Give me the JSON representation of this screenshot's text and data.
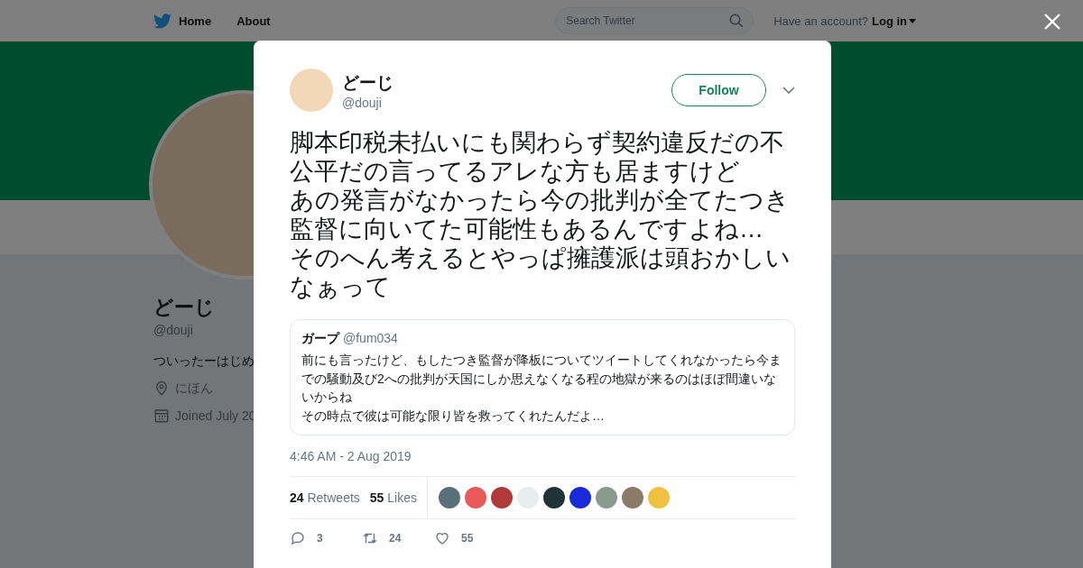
{
  "nav": {
    "items": [
      "Home",
      "About"
    ],
    "search": {
      "placeholder": "Search Twitter"
    },
    "account_prompt": "Have an account?",
    "login": "Log in"
  },
  "profile": {
    "name": "どーじ",
    "handle": "@douji",
    "bio": "ついったーはじめ",
    "location": "にほん",
    "joined": "Joined July 20"
  },
  "tweet": {
    "name": "どーじ",
    "handle": "@douji",
    "follow": "Follow",
    "text": [
      "脚本印税未払いにも関わらず契約違反だの不公平だの言ってるアレな方も居ますけど",
      "あの発言がなかったら今の批判が全てたつき監督に向いてた可能性もあるんですよね…",
      "そのへん考えるとやっぱ擁護派は頭おかしいなぁって"
    ],
    "quote": {
      "name": "ガープ",
      "handle": "@fum034",
      "text": [
        "前にも言ったけど、もしたつき監督が降板についてツイートしてくれなかったら今までの騒動及び2への批判が天国にしか思えなくなる程の地獄が来るのはほぼ間違いないからね",
        "その時点で彼は可能な限り皆を救ってくれたんだよ…"
      ]
    },
    "time": "4:46 AM - 2 Aug 2019",
    "retweets": {
      "count": "24",
      "label": "Retweets"
    },
    "likes": {
      "count": "55",
      "label": "Likes"
    },
    "likers": [
      {
        "color": "#5a6f7a"
      },
      {
        "color": "#e85a5a"
      },
      {
        "color": "#b03a3a"
      },
      {
        "color": "#e8eeee"
      },
      {
        "color": "#1f3338"
      },
      {
        "color": "#1a2ad8"
      },
      {
        "color": "#8a9a90"
      },
      {
        "color": "#8a7a6a"
      },
      {
        "color": "#f0c040"
      }
    ],
    "actions": {
      "replies": "3",
      "retweets": "24",
      "likes": "55"
    }
  }
}
